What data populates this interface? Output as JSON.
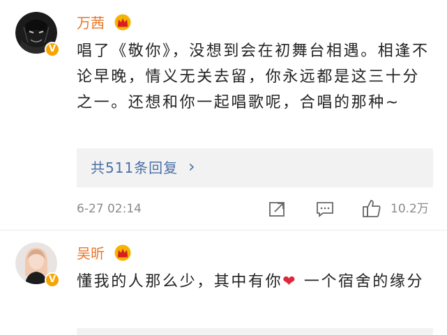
{
  "comments": [
    {
      "username": "万茜",
      "text": "唱了《敬你》，没想到会在初舞台相遇。相逢不论早晚，情义无关去留，你永远都是这三十分之一。还想和你一起唱歌呢，合唱的那种~",
      "reply_summary": "共511条回复",
      "reply_chevron": "›",
      "time": "6-27 02:14",
      "likes": "10.2万",
      "badge": "V"
    },
    {
      "username": "吴昕",
      "text_before_emoji": "懂我的人那么少，其中有你",
      "emoji": "❤",
      "text_after_emoji": " 一个宿舍的缘分",
      "badge": "V"
    }
  ],
  "colors": {
    "username": "#e6772a",
    "reply_link": "#4a6fa5",
    "meta": "#8a8a8a",
    "badge": "#f7a400",
    "heart": "#e0263a"
  },
  "icons": {
    "crown": "crown-icon",
    "repost": "repost-icon",
    "comment": "comment-icon",
    "like": "thumbs-up-icon",
    "chevron": "chevron-right-icon"
  }
}
